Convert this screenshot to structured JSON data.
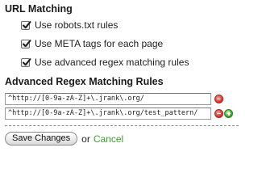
{
  "url_matching": {
    "title": "URL Matching",
    "options": [
      {
        "label": "Use robots.txt rules",
        "checked": true
      },
      {
        "label": "Use META tags for each page",
        "checked": true
      },
      {
        "label": "Use advanced regex matching rules",
        "checked": true
      }
    ]
  },
  "regex_rules": {
    "title": "Advanced Regex Matching Rules",
    "rules": [
      {
        "value": "^http://[0-9a-zA-Z]+\\.jrank\\.org/"
      },
      {
        "value": "^http://[0-9a-zA-Z]+\\.jrank\\.org/test_pattern/"
      }
    ]
  },
  "actions": {
    "save_label": "Save Changes",
    "or_text": "or",
    "cancel_label": "Cancel"
  },
  "colors": {
    "cancel_link": "#3aa12f",
    "remove_button": "#e0403a",
    "add_button": "#4cb13a"
  },
  "icons": {
    "remove": "minus-circle-icon",
    "add": "plus-circle-icon",
    "checkmark": "checkmark-icon"
  }
}
